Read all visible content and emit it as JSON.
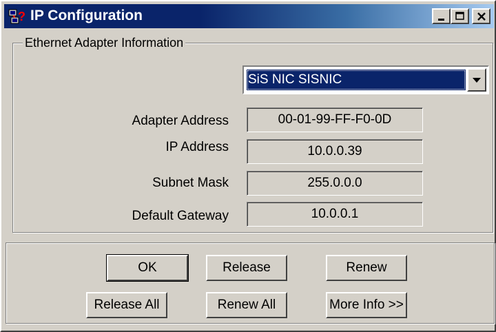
{
  "window": {
    "title": "IP Configuration",
    "controls": [
      "minimize",
      "maximize",
      "close"
    ]
  },
  "adapter_group": {
    "legend": "Ethernet  Adapter Information",
    "selected_adapter": "SiS NIC SISNIC"
  },
  "fields": [
    {
      "label": "Adapter Address",
      "value": "00-01-99-FF-F0-0D"
    },
    {
      "label": "IP Address",
      "value": "10.0.0.39"
    },
    {
      "label": "Subnet Mask",
      "value": "255.0.0.0"
    },
    {
      "label": "Default Gateway",
      "value": "10.0.0.1"
    }
  ],
  "buttons": {
    "ok": "OK",
    "release": "Release",
    "renew": "Renew",
    "release_all": "Release All",
    "renew_all": "Renew All",
    "more_info": "More Info >>"
  },
  "colors": {
    "title_bar": "#0a246a",
    "face": "#d4d0c8",
    "selection": "#0a246a"
  }
}
